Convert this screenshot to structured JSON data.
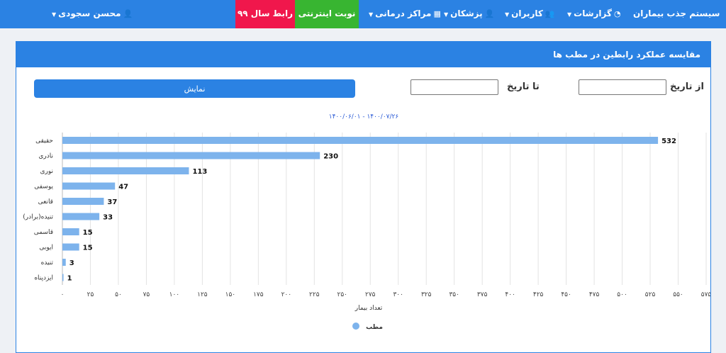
{
  "nav": {
    "brand": "سیستم جذب بیماران",
    "reports": "گزارشات",
    "users": "کاربران",
    "doctors": "پزشکان",
    "centers": "مراکز درمانی",
    "online": "نوبت اینترنتی",
    "rabet": "رابط سال ۹۹",
    "user": "محسن سجودی"
  },
  "card": {
    "title": "مقایسه عملکرد رابطین در مطب ها",
    "from_label": "از تاریخ",
    "to_label": "تا تاریخ",
    "from_value": "",
    "to_value": "",
    "show_button": "نمایش"
  },
  "colors": {
    "primary": "#2b82e3",
    "bar": "#7db3ec",
    "red": "#f0174c",
    "green": "#38b531"
  },
  "icons": {
    "reports": "dashboard-icon",
    "users": "users-icon",
    "doctors": "doctor-icon",
    "centers": "hospital-icon",
    "user": "user-icon",
    "caret": "caret-down-icon",
    "legend": "legend-dot-icon"
  },
  "chart_data": {
    "type": "bar",
    "orientation": "horizontal",
    "subtitle": "۱۴۰۰/۰۶/۰۱ - ۱۴۰۰/۰۷/۲۶",
    "categories": [
      "حقیقی",
      "نادری",
      "نوری",
      "یوسفی",
      "قانعی",
      "(تنیده(برادر",
      "قاسمی",
      "ایوبی",
      "تنیده",
      "ایزدپناه"
    ],
    "values": [
      532,
      230,
      113,
      47,
      37,
      33,
      15,
      15,
      3,
      1
    ],
    "value_labels": [
      "532",
      "230",
      "113",
      "47",
      "37",
      "33",
      "15",
      "15",
      "3",
      "1"
    ],
    "xlim": [
      0,
      575
    ],
    "ticks": [
      "۰",
      "۲۵",
      "۵۰",
      "۷۵",
      "۱۰۰",
      "۱۲۵",
      "۱۵۰",
      "۱۷۵",
      "۲۰۰",
      "۲۲۵",
      "۲۵۰",
      "۲۷۵",
      "۳۰۰",
      "۳۲۵",
      "۳۵۰",
      "۳۷۵",
      "۴۰۰",
      "۴۲۵",
      "۴۵۰",
      "۴۷۵",
      "۵۰۰",
      "۵۲۵",
      "۵۵۰",
      "۵۷۵"
    ],
    "xlabel": "تعداد بیمار",
    "legend": "مطب",
    "grid": true
  }
}
